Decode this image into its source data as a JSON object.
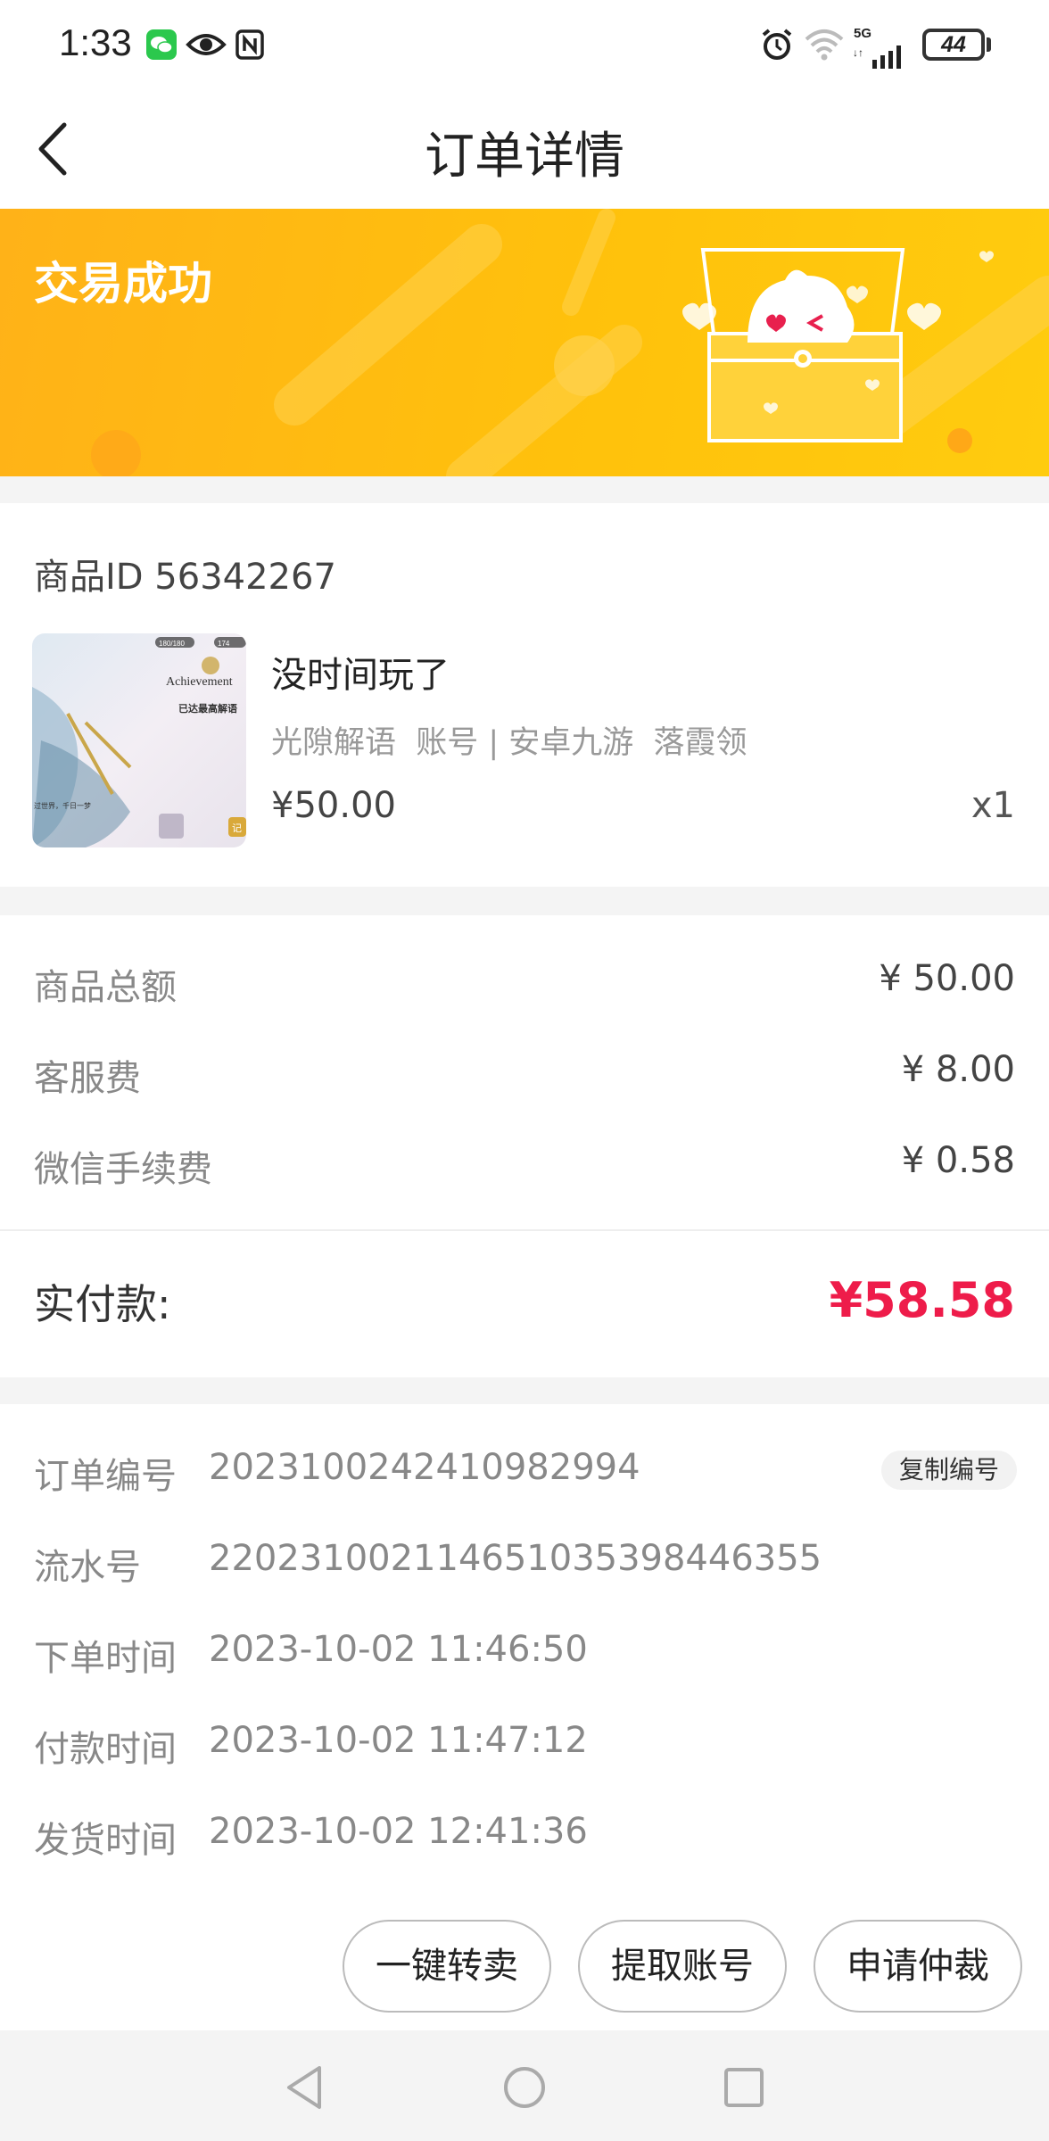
{
  "status_bar": {
    "time": "1:33",
    "network": "5G",
    "battery": "44",
    "icons": [
      "wechat-icon",
      "eye-icon",
      "nfc-icon",
      "alarm-icon",
      "wifi-icon",
      "signal-icon",
      "battery-icon"
    ]
  },
  "header": {
    "title": "订单详情",
    "back_icon": "back-arrow-icon"
  },
  "banner": {
    "status_text": "交易成功",
    "illustration": "treasure-chest-illustration"
  },
  "product": {
    "id_label": "商品ID 56342267",
    "name": "没时间玩了",
    "tags": "光隙解语  账号 | 安卓九游  落霞领",
    "price": "¥50.00",
    "quantity": "x1",
    "thumbnail": {
      "title_text": "Achievement",
      "caption": "已达最高解语",
      "counter_1": "180/180",
      "counter_2": "174",
      "bottom_text": "过世界，千日一梦",
      "corner_text": "记"
    }
  },
  "fees": {
    "items": [
      {
        "label": "商品总额",
        "value": "¥ 50.00"
      },
      {
        "label": "客服费",
        "value": "¥ 8.00"
      },
      {
        "label": "微信手续费",
        "value": "¥ 0.58"
      }
    ],
    "total_label": "实付款:",
    "total_value": "¥58.58"
  },
  "order_info": {
    "order_no_label": "订单编号",
    "order_no": "2023100242410982994",
    "copy_label": "复制编号",
    "serial_label": "流水号",
    "serial_no": "2202310021146510353984463​55",
    "order_time_label": "下单时间",
    "order_time": "2023-10-02 11:46:50",
    "pay_time_label": "付款时间",
    "pay_time": "2023-10-02 11:47:12",
    "ship_time_label": "发货时间",
    "ship_time": "2023-10-02 12:41:36"
  },
  "actions": {
    "resell": "一键转卖",
    "retrieve": "提取账号",
    "arbitration": "申请仲裁"
  },
  "colors": {
    "banner": "#ffc10c",
    "total_price": "#ee1c4a",
    "page_bg": "#f4f4f4"
  }
}
